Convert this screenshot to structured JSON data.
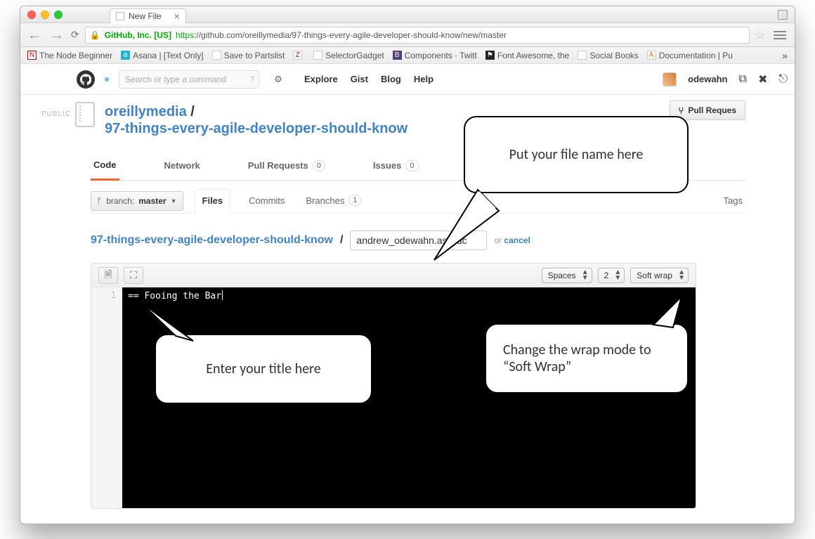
{
  "browser": {
    "tab_title": "New File",
    "cert_owner": "GitHub, Inc. [US]",
    "url_https": "https",
    "url_rest": "://github.com/oreillymedia/97-things-every-agile-developer-should-know/new/master"
  },
  "bookmarks": [
    "The Node Beginner",
    "Asana | [Text Only]",
    "Save to Partslist",
    "",
    "SelectorGadget",
    "Components · Twitt",
    "Font Awesome, the",
    "Social Books",
    "Documentation | Pu"
  ],
  "github_header": {
    "search_placeholder": "Search or type a command",
    "links": [
      "Explore",
      "Gist",
      "Blog",
      "Help"
    ],
    "username": "odewahn"
  },
  "repo": {
    "visibility": "PUBLIC",
    "owner": "oreillymedia",
    "name": "97-things-every-agile-developer-should-know",
    "pull_request_btn": "Pull Reques"
  },
  "main_tabs": {
    "code": "Code",
    "network": "Network",
    "pull_requests": {
      "label": "Pull Requests",
      "count": "0"
    },
    "issues": {
      "label": "Issues",
      "count": "0"
    }
  },
  "branch": {
    "label": "branch:",
    "name": "master"
  },
  "subtabs": {
    "files": "Files",
    "commits": "Commits",
    "branches": {
      "label": "Branches",
      "count": "1"
    },
    "tags": "Tags"
  },
  "path": {
    "repo": "97-things-every-agile-developer-should-know",
    "filename_value": "andrew_odewahn.asciidc",
    "or": "or",
    "cancel": "cancel"
  },
  "editor": {
    "indent_mode": "Spaces",
    "indent_size": "2",
    "wrap_mode": "Soft wrap",
    "line_number": "1",
    "line1": "== Fooing the Bar"
  },
  "annotations": {
    "a1": "Put your file name here",
    "a2": "Enter your title here",
    "a3": "Change the wrap mode to “Soft Wrap”"
  }
}
